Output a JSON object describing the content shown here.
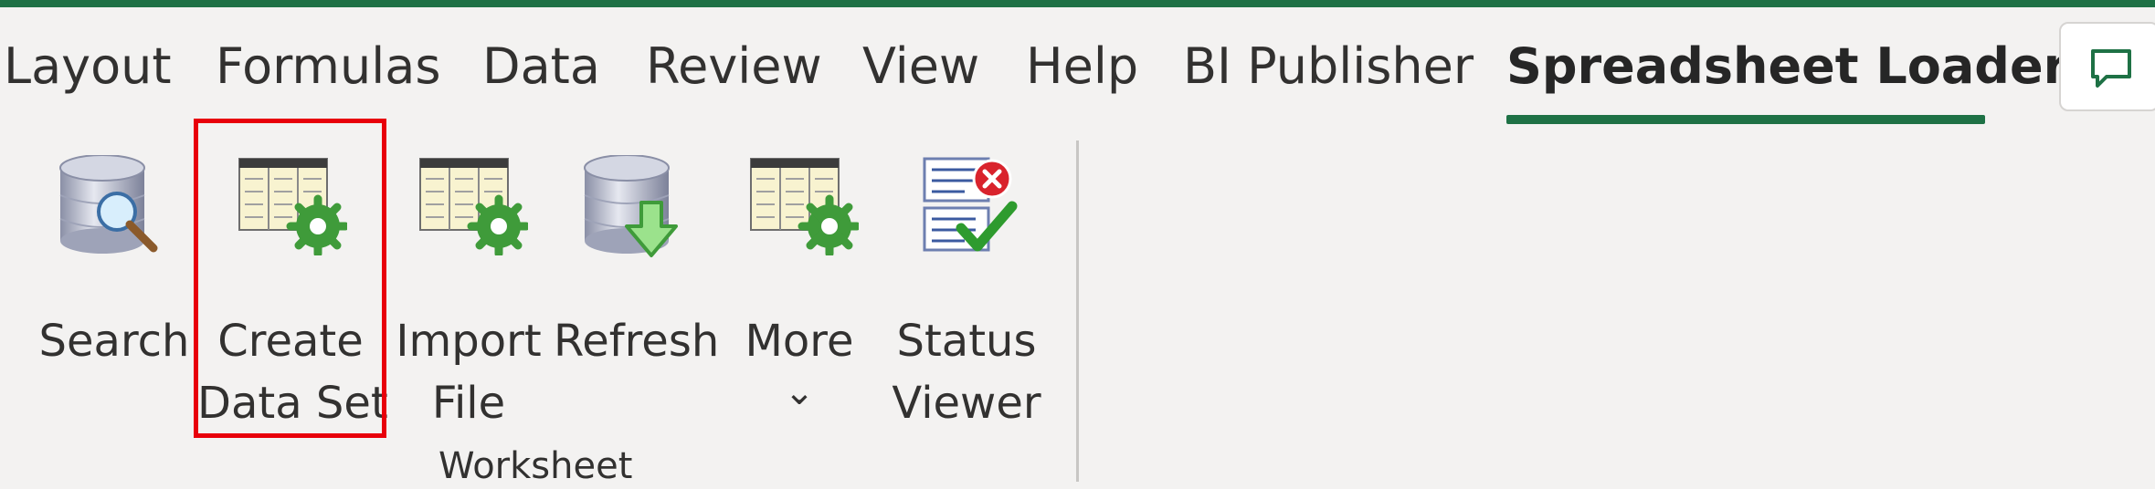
{
  "ribbon": {
    "tabs": [
      {
        "label": "Layout"
      },
      {
        "label": "Formulas"
      },
      {
        "label": "Data"
      },
      {
        "label": "Review"
      },
      {
        "label": "View"
      },
      {
        "label": "Help"
      },
      {
        "label": "BI Publisher"
      },
      {
        "label": "Spreadsheet Loader",
        "active": true
      }
    ],
    "accent_color": "#1e7145",
    "highlight_color": "#e8000b"
  },
  "worksheet_group": {
    "label": "Worksheet",
    "buttons": [
      {
        "label_lines": [
          "Search"
        ],
        "icon": "database-search-icon"
      },
      {
        "label_lines": [
          "Create",
          "Data Set"
        ],
        "icon": "table-gear-icon",
        "highlighted": true
      },
      {
        "label_lines": [
          "Import",
          "File"
        ],
        "icon": "table-gear-icon"
      },
      {
        "label_lines": [
          "Refresh"
        ],
        "icon": "database-download-icon"
      },
      {
        "label_lines": [
          "More",
          "⌄"
        ],
        "icon": "table-gear-icon"
      },
      {
        "label_lines": [
          "Status",
          "Viewer"
        ],
        "icon": "status-viewer-icon"
      }
    ]
  }
}
